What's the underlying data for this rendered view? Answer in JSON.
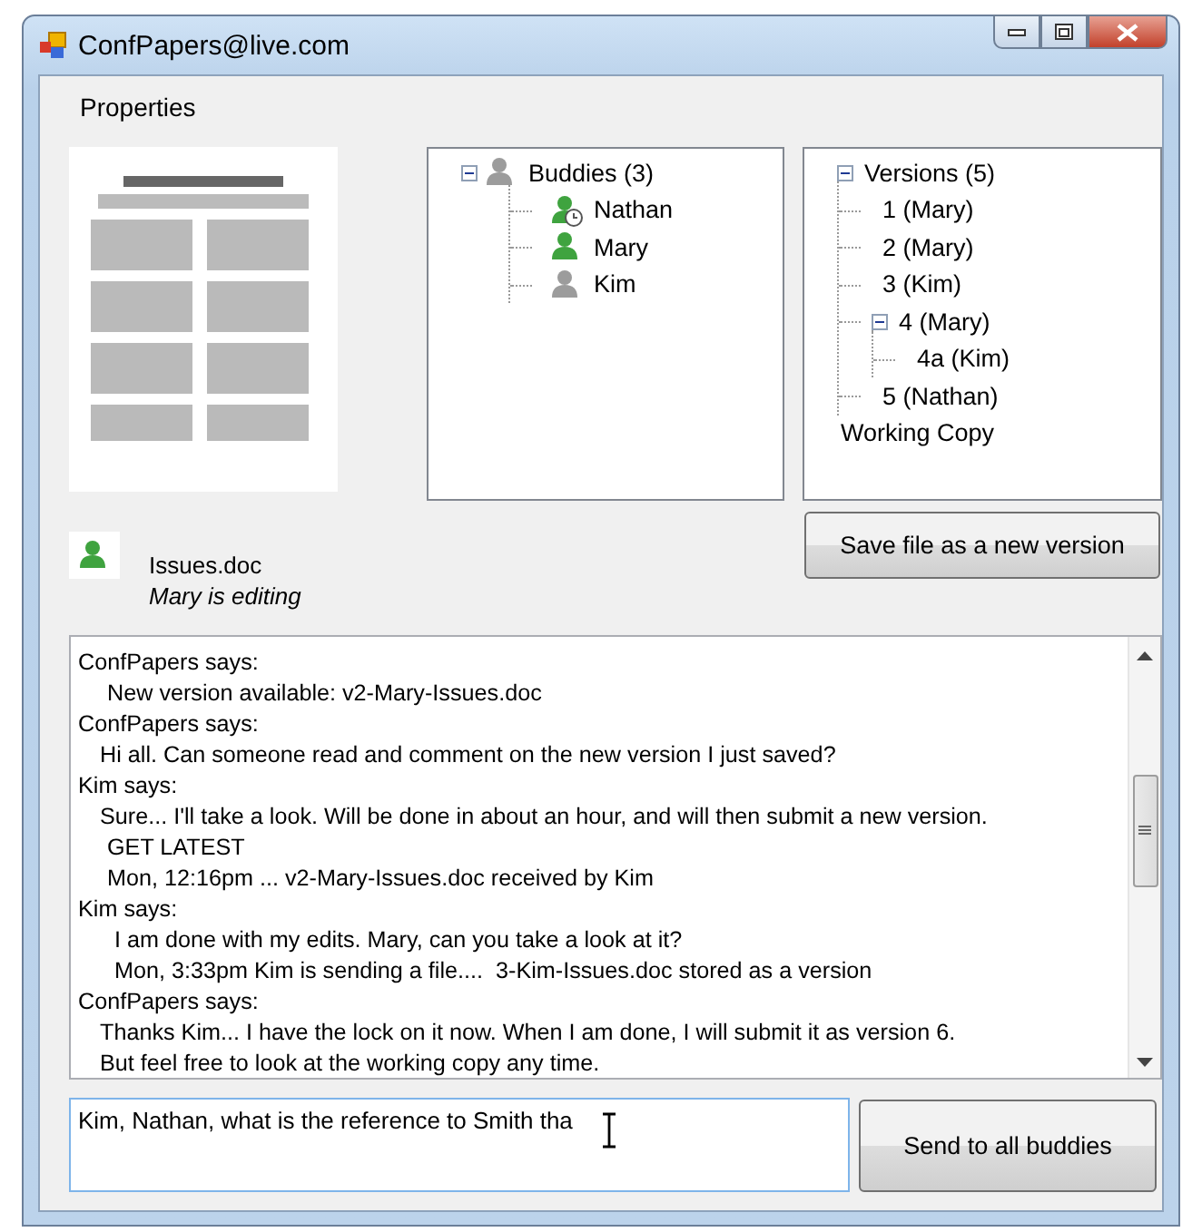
{
  "window": {
    "title": "ConfPapers@live.com"
  },
  "menu": [
    {
      "label": "Properties"
    }
  ],
  "document": {
    "file_name": "Issues.doc",
    "status": "Mary is editing"
  },
  "buddies": {
    "label": "Buddies (3)",
    "expanded": true,
    "children": [
      {
        "label": "Nathan",
        "kind": "away"
      },
      {
        "label": "Mary",
        "kind": "online"
      },
      {
        "label": "Kim",
        "kind": "offline"
      }
    ]
  },
  "versions": {
    "label": "Versions (5)",
    "expanded": true,
    "children": [
      {
        "label": "1 (Mary)"
      },
      {
        "label": "2 (Mary)"
      },
      {
        "label": "3 (Kim)"
      },
      {
        "label": "4 (Mary)",
        "expanded": true,
        "children": [
          {
            "label": "4a (Kim)"
          }
        ]
      },
      {
        "label": "5 (Nathan)"
      }
    ]
  },
  "working_copy": {
    "label": "Working Copy"
  },
  "save_button": "Save file as a new version",
  "chat": [
    {
      "kind": "sender",
      "text": "ConfPapers says:"
    },
    {
      "kind": "notice",
      "text": "New version available: v2-Mary-Issues.doc"
    },
    {
      "kind": "sender",
      "text": "ConfPapers says:"
    },
    {
      "kind": "message",
      "text": "Hi all. Can someone read and comment on the new version I just saved?"
    },
    {
      "kind": "sender",
      "text": "Kim says:"
    },
    {
      "kind": "message",
      "text": "Sure... I'll take a look. Will be done in about an hour, and will then submit a new version."
    },
    {
      "kind": "notice",
      "text": "GET LATEST"
    },
    {
      "kind": "notice",
      "text": "Mon, 12:16pm ... v2-Mary-Issues.doc received by Kim"
    },
    {
      "kind": "sender",
      "text": "Kim says:"
    },
    {
      "kind": "event",
      "text": "I am done with my edits. Mary, can you take a look at it?"
    },
    {
      "kind": "event",
      "text": "Mon, 3:33pm Kim is sending a file....  3-Kim-Issues.doc stored as a version"
    },
    {
      "kind": "sender",
      "text": "ConfPapers says:"
    },
    {
      "kind": "message",
      "text": "Thanks Kim... I have the lock on it now. When I am done, I will submit it as version 6."
    },
    {
      "kind": "message",
      "text": "But feel free to look at the working copy any time."
    }
  ],
  "message_field": {
    "value": "Kim, Nathan, what is the reference to Smith tha"
  },
  "send_button": "Send to all buddies"
}
